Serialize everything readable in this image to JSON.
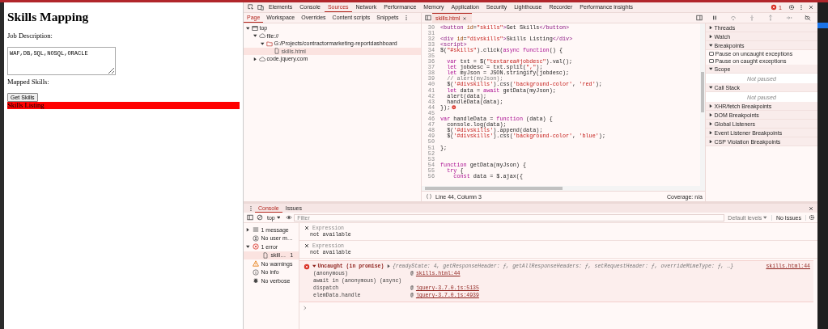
{
  "page": {
    "title": "Skills Mapping",
    "job_label": "Job Description:",
    "job_value": "WAF,DB,SQL,NOSQL,ORACLE",
    "mapped_label": "Mapped Skills:",
    "button": "Get Skills",
    "listing": {
      "text": "Skills Listing",
      "color": "#ff0000"
    }
  },
  "devtools": {
    "main_tabs": [
      {
        "label": "Elements",
        "selected": false
      },
      {
        "label": "Console",
        "selected": false
      },
      {
        "label": "Sources",
        "selected": true
      },
      {
        "label": "Network",
        "selected": false
      },
      {
        "label": "Performance",
        "selected": false
      },
      {
        "label": "Memory",
        "selected": false
      },
      {
        "label": "Application",
        "selected": false
      },
      {
        "label": "Security",
        "selected": false
      },
      {
        "label": "Lighthouse",
        "selected": false
      },
      {
        "label": "Recorder",
        "selected": false
      },
      {
        "label": "Performance insights",
        "selected": false
      }
    ],
    "error_count": "1",
    "nav_tabs": [
      {
        "label": "Page",
        "selected": true
      },
      {
        "label": "Workspace",
        "selected": false
      },
      {
        "label": "Overrides",
        "selected": false
      },
      {
        "label": "Content scripts",
        "selected": false
      },
      {
        "label": "Snippets",
        "selected": false
      }
    ],
    "file_tab": "skills.html",
    "tree": [
      {
        "label": "top",
        "kind": "frame",
        "expanded": true,
        "selected": false,
        "children": [
          {
            "label": "file://",
            "kind": "origin",
            "expanded": true,
            "selected": false,
            "children": [
              {
                "label": "G:/Projects/contractormarketing-reportdashboard",
                "kind": "folder",
                "expanded": true,
                "selected": false,
                "children": [
                  {
                    "label": "skills.html",
                    "kind": "file",
                    "selected": true
                  }
                ]
              }
            ]
          },
          {
            "label": "code.jquery.com",
            "kind": "origin",
            "expanded": false,
            "selected": false
          }
        ]
      }
    ],
    "code": {
      "lines": [
        {
          "number": "30",
          "tokens": [
            {
              "kind": "tag",
              "text": "<button"
            },
            {
              "kind": "attr",
              "text": " id"
            },
            {
              "kind": "plain",
              "text": "="
            },
            {
              "kind": "string",
              "text": "\"skills\""
            },
            {
              "kind": "tag",
              "text": ">"
            },
            {
              "kind": "plain",
              "text": "Get Skills"
            },
            {
              "kind": "tag",
              "text": "</button>"
            }
          ]
        },
        {
          "number": "31"
        },
        {
          "number": "32",
          "tokens": [
            {
              "kind": "tag",
              "text": "<div"
            },
            {
              "kind": "attr",
              "text": " id"
            },
            {
              "kind": "plain",
              "text": "="
            },
            {
              "kind": "string",
              "text": "\"divskills\""
            },
            {
              "kind": "tag",
              "text": ">"
            },
            {
              "kind": "plain",
              "text": "Skills Listing"
            },
            {
              "kind": "tag",
              "text": "</div>"
            }
          ]
        },
        {
          "number": "33",
          "tokens": [
            {
              "kind": "tag",
              "text": "<script>"
            }
          ]
        },
        {
          "number": "34",
          "tokens": [
            {
              "kind": "plain",
              "text": "$("
            },
            {
              "kind": "string",
              "text": "\"#skills\""
            },
            {
              "kind": "plain",
              "text": ").click("
            },
            {
              "kind": "keyword",
              "text": "async"
            },
            {
              "kind": "keyword",
              "text": " function"
            },
            {
              "kind": "plain",
              "text": "() {"
            }
          ]
        },
        {
          "number": "35"
        },
        {
          "number": "36",
          "tokens": [
            {
              "kind": "keyword",
              "text": "  var"
            },
            {
              "kind": "plain",
              "text": " txt = $("
            },
            {
              "kind": "string",
              "text": "\"textarea#jobdesc\""
            },
            {
              "kind": "plain",
              "text": ").val();"
            }
          ]
        },
        {
          "number": "37",
          "tokens": [
            {
              "kind": "keyword",
              "text": "  let"
            },
            {
              "kind": "plain",
              "text": " jobdesc = txt.split("
            },
            {
              "kind": "string",
              "text": "\",\""
            },
            {
              "kind": "plain",
              "text": ");"
            }
          ]
        },
        {
          "number": "38",
          "tokens": [
            {
              "kind": "keyword",
              "text": "  let"
            },
            {
              "kind": "plain",
              "text": " myJson = JSON.stringify(jobdesc);"
            }
          ]
        },
        {
          "number": "39",
          "tokens": [
            {
              "kind": "comment",
              "text": "  // alert(myJson);"
            }
          ]
        },
        {
          "number": "40",
          "tokens": [
            {
              "kind": "plain",
              "text": "  $("
            },
            {
              "kind": "string",
              "text": "'#divskills'"
            },
            {
              "kind": "plain",
              "text": ").css("
            },
            {
              "kind": "string",
              "text": "'background-color'"
            },
            {
              "kind": "plain",
              "text": ", "
            },
            {
              "kind": "string",
              "text": "'red'"
            },
            {
              "kind": "plain",
              "text": ");"
            }
          ]
        },
        {
          "number": "41",
          "tokens": [
            {
              "kind": "keyword",
              "text": "  let"
            },
            {
              "kind": "plain",
              "text": " data = "
            },
            {
              "kind": "keyword",
              "text": "await"
            },
            {
              "kind": "plain",
              "text": " getData(myJson);"
            }
          ]
        },
        {
          "number": "42",
          "tokens": [
            {
              "kind": "plain",
              "text": "  alert(data);"
            }
          ]
        },
        {
          "number": "43",
          "tokens": [
            {
              "kind": "plain",
              "text": "  handleData(data);"
            }
          ]
        },
        {
          "number": "44",
          "error": true,
          "tokens": [
            {
              "kind": "plain",
              "text": "});"
            }
          ]
        },
        {
          "number": "45"
        },
        {
          "number": "46",
          "tokens": [
            {
              "kind": "keyword",
              "text": "var"
            },
            {
              "kind": "plain",
              "text": " handleData = "
            },
            {
              "kind": "keyword",
              "text": "function"
            },
            {
              "kind": "plain",
              "text": " (data) {"
            }
          ]
        },
        {
          "number": "47",
          "tokens": [
            {
              "kind": "plain",
              "text": "  console.log(data);"
            }
          ]
        },
        {
          "number": "48",
          "tokens": [
            {
              "kind": "plain",
              "text": "  $("
            },
            {
              "kind": "string",
              "text": "'#divskills'"
            },
            {
              "kind": "plain",
              "text": ").append(data);"
            }
          ]
        },
        {
          "number": "49",
          "tokens": [
            {
              "kind": "plain",
              "text": "  $("
            },
            {
              "kind": "string",
              "text": "'#divskills'"
            },
            {
              "kind": "plain",
              "text": ").css("
            },
            {
              "kind": "string",
              "text": "'background-color'"
            },
            {
              "kind": "plain",
              "text": ", "
            },
            {
              "kind": "string",
              "text": "'blue'"
            },
            {
              "kind": "plain",
              "text": ");"
            }
          ]
        },
        {
          "number": "50"
        },
        {
          "number": "51",
          "tokens": [
            {
              "kind": "plain",
              "text": "};"
            }
          ]
        },
        {
          "number": "52"
        },
        {
          "number": "53"
        },
        {
          "number": "54",
          "tokens": [
            {
              "kind": "keyword",
              "text": "function"
            },
            {
              "kind": "plain",
              "text": " getData(myJson) {"
            }
          ]
        },
        {
          "number": "55",
          "tokens": [
            {
              "kind": "keyword",
              "text": "  try"
            },
            {
              "kind": "plain",
              "text": " {"
            }
          ]
        },
        {
          "number": "56",
          "tokens": [
            {
              "kind": "keyword",
              "text": "    const"
            },
            {
              "kind": "plain",
              "text": " data = $.ajax({"
            }
          ]
        }
      ],
      "status": "Line 44, Column 3",
      "coverage": "Coverage: n/a"
    },
    "debugger": [
      {
        "title": "Threads",
        "expanded": false
      },
      {
        "title": "Watch",
        "expanded": false
      },
      {
        "title": "Breakpoints",
        "expanded": true,
        "checkboxes": [
          {
            "label": "Pause on uncaught exceptions",
            "checked": false
          },
          {
            "label": "Pause on caught exceptions",
            "checked": false
          }
        ]
      },
      {
        "title": "Scope",
        "expanded": true,
        "message": "Not paused"
      },
      {
        "title": "Call Stack",
        "expanded": true,
        "message": "Not paused"
      },
      {
        "title": "XHR/fetch Breakpoints",
        "expanded": false
      },
      {
        "title": "DOM Breakpoints",
        "expanded": false
      },
      {
        "title": "Global Listeners",
        "expanded": false
      },
      {
        "title": "Event Listener Breakpoints",
        "expanded": false
      },
      {
        "title": "CSP Violation Breakpoints",
        "expanded": false
      }
    ]
  },
  "drawer": {
    "tabs": [
      {
        "label": "Console",
        "selected": true
      },
      {
        "label": "Issues",
        "selected": false
      }
    ],
    "context": "top",
    "filter_placeholder": "Filter",
    "levels": "Default levels",
    "issues": "No Issues",
    "sidebar": [
      {
        "label": "1 message",
        "kind": "messages",
        "expanded": false,
        "selected": false
      },
      {
        "label": "No user m…",
        "kind": "user",
        "selected": false
      },
      {
        "label": "1 error",
        "kind": "errors",
        "expanded": true,
        "selected": false,
        "children": [
          {
            "label": "skill…",
            "count": "1",
            "kind": "file",
            "selected": true
          }
        ]
      },
      {
        "label": "No warnings",
        "kind": "warnings",
        "selected": false
      },
      {
        "label": "No info",
        "kind": "info",
        "selected": false
      },
      {
        "label": "No verbose",
        "kind": "verbose",
        "selected": false
      }
    ],
    "live_expressions": [
      {
        "placeholder": "Expression",
        "value": "not available"
      },
      {
        "placeholder": "Expression",
        "value": "not available"
      }
    ],
    "messages": [
      {
        "kind": "error",
        "head": "Uncaught (in promise)",
        "object": "{readyState: 4, getResponseHeader: ƒ, getAllResponseHeaders: ƒ, setRequestHeader: ƒ, overrideMimeType: ƒ, …}",
        "source": "skills.html:44",
        "stack": [
          {
            "fn": "(anonymous)",
            "at": "@",
            "source": "skills.html:44"
          },
          {
            "fn": "await in (anonymous) (async)"
          },
          {
            "fn": "dispatch",
            "at": "@",
            "source": "jquery-3.7.0.js:5135"
          },
          {
            "fn": "elemData.handle",
            "at": "@",
            "source": "jquery-3.7.0.js:4939"
          }
        ]
      }
    ]
  }
}
